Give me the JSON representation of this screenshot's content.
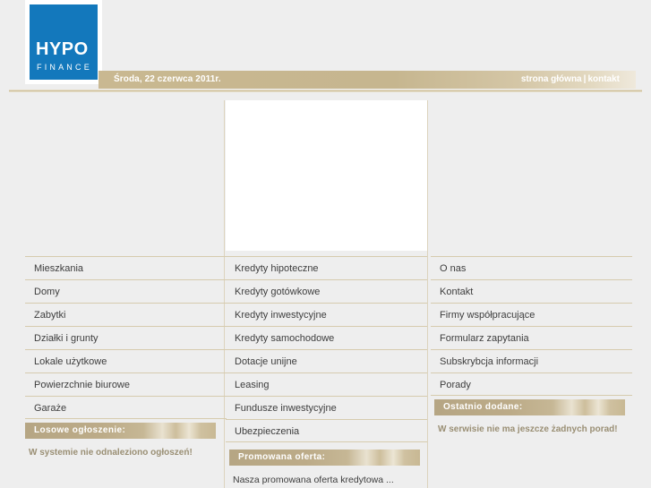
{
  "brand": {
    "logo_line1": "HYPO",
    "logo_line2": "FINANCE",
    "logo_color": "#1378bc"
  },
  "topbar": {
    "date": "Środa, 22 czerwca 2011r.",
    "home_label": "strona główna",
    "separator": "|",
    "contact_label": "kontakt",
    "background_color": "#c6b68f"
  },
  "columns": {
    "left": {
      "items": [
        {
          "label": "Mieszkania"
        },
        {
          "label": "Domy"
        },
        {
          "label": "Zabytki"
        },
        {
          "label": "Działki i grunty"
        },
        {
          "label": "Lokale użytkowe"
        },
        {
          "label": "Powierzchnie biurowe"
        },
        {
          "label": "Garaże"
        }
      ],
      "panel": {
        "title": "Losowe ogłoszenie:",
        "text": "W systemie nie odnaleziono ogłoszeń!"
      }
    },
    "middle": {
      "items": [
        {
          "label": "Kredyty hipoteczne"
        },
        {
          "label": "Kredyty gotówkowe"
        },
        {
          "label": "Kredyty inwestycyjne"
        },
        {
          "label": "Kredyty samochodowe"
        },
        {
          "label": "Dotacje unijne"
        },
        {
          "label": "Leasing"
        },
        {
          "label": "Fundusze inwestycyjne"
        },
        {
          "label": "Ubezpieczenia"
        }
      ],
      "panel": {
        "title": "Promowana oferta:",
        "text": "Nasza promowana oferta kredytowa ..."
      }
    },
    "right": {
      "items": [
        {
          "label": "O nas"
        },
        {
          "label": "Kontakt"
        },
        {
          "label": "Firmy współpracujące"
        },
        {
          "label": "Formularz zapytania"
        },
        {
          "label": "Subskrybcja informacji"
        },
        {
          "label": "Porady"
        }
      ],
      "panel": {
        "title": "Ostatnio dodane:",
        "text": "W serwisie nie ma jeszcze żadnych porad!"
      }
    }
  }
}
